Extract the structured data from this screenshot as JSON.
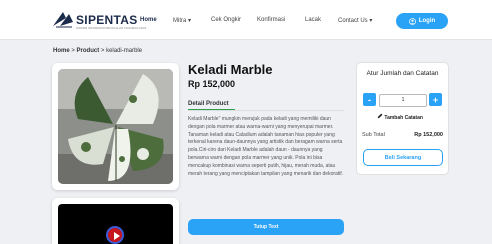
{
  "nav": {
    "brand": "SIPENTAS",
    "brand_sub": "SISTEM INFORMASI PENJUALAN TANAMAN HIAS",
    "items": [
      {
        "label": "Home",
        "active": true
      },
      {
        "label": "Mitra ▾",
        "active": false
      },
      {
        "label": "Cek Ongkir",
        "active": false
      },
      {
        "label": "Konfirmasi",
        "active": false
      },
      {
        "label": "Lacak",
        "active": false
      },
      {
        "label": "Contact Us ▾",
        "active": false
      }
    ],
    "login_label": "Login",
    "accent": "#2aa2f5"
  },
  "breadcrumb": {
    "home": "Home",
    "sep": ">",
    "product": "Product",
    "current": "keladi-marble"
  },
  "product": {
    "title": "Keladi Marble",
    "price": "Rp 152,000",
    "tab_label": "Detail Product",
    "description": "Keladi Marble\" mungkin merujuk pada keladi yang memiliki daun dengan pola marmer atau warna-warni yang menyerupai marmer. Tanaman keladi atau Caladium adalah tanaman hias populer yang terkenal karena daun-daunnya yang artistik dan beragam warna serta pola.Ciri-ciro dari Keladi Marble adalah daun - daunnya yang berwarna warni dengan pola marmer yang unik. Pola ini bisa mencakup kombinasi warna seperti putih, hijau, merah muda, atau merah terang yang menciptakan tampilan yang menarik dan dekoratif.",
    "close_label": "Tutup Text"
  },
  "order": {
    "title": "Atur Jumlah dan Catatan",
    "minus": "-",
    "plus": "+",
    "quantity": "1",
    "note_label": "Tambah Catatan",
    "subtotal_label": "Sub Total",
    "subtotal_value": "Rp 152,000",
    "buy_label": "Beli Sekarang"
  },
  "icons": {
    "logo": "leaf-logo-icon",
    "login": "user-icon",
    "note": "pencil-icon",
    "video": "play-icon"
  }
}
